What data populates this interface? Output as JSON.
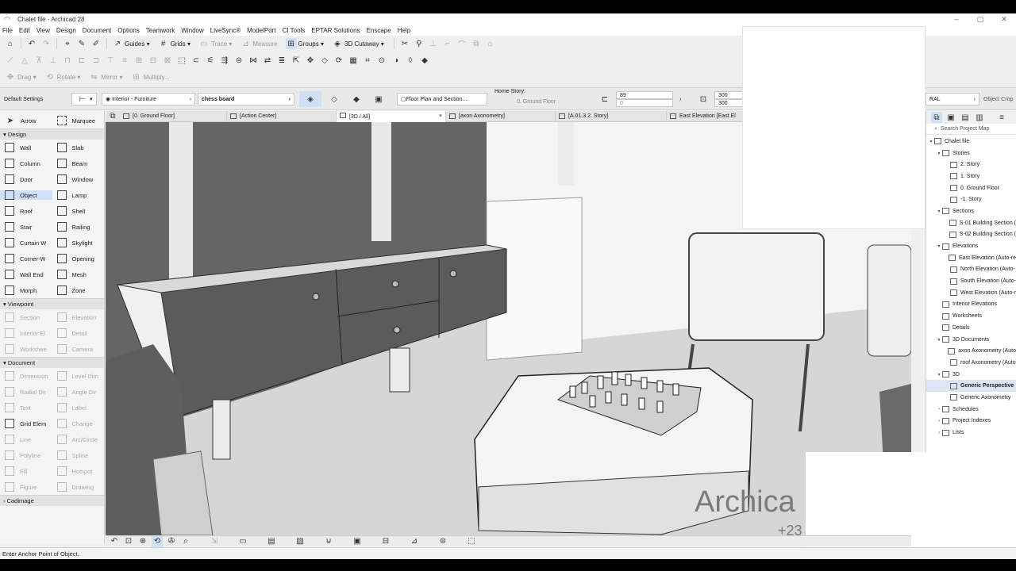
{
  "window": {
    "title": "Chalet file - Archicad 28",
    "controls": [
      "–",
      "▢",
      "✕"
    ]
  },
  "menu": [
    "File",
    "Edit",
    "View",
    "Design",
    "Document",
    "Options",
    "Teamwork",
    "Window",
    "LiveSync®",
    "ModelPort",
    "CI Tools",
    "EPTAR Solutions",
    "Enscape",
    "Help"
  ],
  "toolbar1": {
    "guides": "Guides",
    "grids": "Grids",
    "trace": "Trace",
    "measure": "Measure",
    "groups": "Groups",
    "cutaway": "3D Cutaway"
  },
  "toolbar3": {
    "drag": "Drag",
    "rotate": "Rotate",
    "mirror": "Mirror",
    "multiply": "Multiply..."
  },
  "infobox": {
    "default_settings": "Default Settings",
    "layer": "Interior - Furniture",
    "object_name": "chess board",
    "view_mode": "Floor Plan and Section...",
    "home_story_label": "Home Story:",
    "home_story": "0. Ground Floor",
    "elev1": "89",
    "elev2": "0",
    "dim1": "300",
    "dim2": "300",
    "right_field": "RAL",
    "object_crop": "Object Crop"
  },
  "tabs": [
    {
      "label": "[0. Ground Floor]",
      "active": false
    },
    {
      "label": "[Action Center]",
      "active": false
    },
    {
      "label": "[3D / All]",
      "active": true,
      "close": "×"
    },
    {
      "label": "[axon Axonometry]",
      "active": false
    },
    {
      "label": "[A.01.3 2. Story]",
      "active": false
    },
    {
      "label": "East Elevation [East El",
      "active": false
    }
  ],
  "toolbox": {
    "top": [
      {
        "label": "Arrow"
      },
      {
        "label": "Marquee"
      }
    ],
    "sections": [
      {
        "title": "Design",
        "tools": [
          {
            "label": "Wall"
          },
          {
            "label": "Slab"
          },
          {
            "label": "Column"
          },
          {
            "label": "Beam"
          },
          {
            "label": "Door"
          },
          {
            "label": "Window"
          },
          {
            "label": "Object",
            "selected": true
          },
          {
            "label": "Lamp"
          },
          {
            "label": "Roof"
          },
          {
            "label": "Shell"
          },
          {
            "label": "Stair"
          },
          {
            "label": "Railing"
          },
          {
            "label": "Curtain W"
          },
          {
            "label": "Skylight"
          },
          {
            "label": "Corner-W"
          },
          {
            "label": "Opening"
          },
          {
            "label": "Wall End"
          },
          {
            "label": "Mesh"
          },
          {
            "label": "Morph"
          },
          {
            "label": "Zone"
          }
        ]
      },
      {
        "title": "Viewpoint",
        "tools": [
          {
            "label": "Section",
            "dim": true
          },
          {
            "label": "Elevation",
            "dim": true
          },
          {
            "label": "Interior El",
            "dim": true
          },
          {
            "label": "Detail",
            "dim": true
          },
          {
            "label": "Workshee",
            "dim": true
          },
          {
            "label": "Camera",
            "dim": true
          }
        ]
      },
      {
        "title": "Document",
        "tools": [
          {
            "label": "Dimension",
            "dim": true
          },
          {
            "label": "Level Dim",
            "dim": true
          },
          {
            "label": "Radial Dir",
            "dim": true
          },
          {
            "label": "Angle Dir",
            "dim": true
          },
          {
            "label": "Text",
            "dim": true
          },
          {
            "label": "Label",
            "dim": true
          },
          {
            "label": "Grid Elem"
          },
          {
            "label": "Change",
            "dim": true
          },
          {
            "label": "Line",
            "dim": true
          },
          {
            "label": "Arc/Circle",
            "dim": true
          },
          {
            "label": "Polyline",
            "dim": true
          },
          {
            "label": "Spline",
            "dim": true
          },
          {
            "label": "Fill",
            "dim": true
          },
          {
            "label": "Hotspot",
            "dim": true
          },
          {
            "label": "Figure",
            "dim": true
          },
          {
            "label": "Drawing",
            "dim": true
          }
        ]
      }
    ],
    "last_section": "Cadimage"
  },
  "navigator": {
    "search_placeholder": "Search Project Map",
    "items": [
      {
        "label": "Chalet file",
        "level": 0,
        "arrow": "▾"
      },
      {
        "label": "Stories",
        "level": 1,
        "arrow": "▾"
      },
      {
        "label": "2. Story",
        "level": 2,
        "arrow": ""
      },
      {
        "label": "1. Story",
        "level": 2,
        "arrow": ""
      },
      {
        "label": "0. Ground Floor",
        "level": 2,
        "arrow": ""
      },
      {
        "label": "-1. Story",
        "level": 2,
        "arrow": ""
      },
      {
        "label": "Sections",
        "level": 1,
        "arrow": "▾"
      },
      {
        "label": "S-01 Building Section (",
        "level": 2,
        "arrow": ""
      },
      {
        "label": "S-02 Building Section (",
        "level": 2,
        "arrow": ""
      },
      {
        "label": "Elevations",
        "level": 1,
        "arrow": "▾"
      },
      {
        "label": "East Elevation (Auto-re",
        "level": 2,
        "arrow": ""
      },
      {
        "label": "North Elevation (Auto-",
        "level": 2,
        "arrow": ""
      },
      {
        "label": "South Elevation (Auto-",
        "level": 2,
        "arrow": ""
      },
      {
        "label": "West Elevation (Auto-r",
        "level": 2,
        "arrow": ""
      },
      {
        "label": "Interior Elevations",
        "level": 1,
        "arrow": ""
      },
      {
        "label": "Worksheets",
        "level": 1,
        "arrow": ""
      },
      {
        "label": "Details",
        "level": 1,
        "arrow": ""
      },
      {
        "label": "3D Documents",
        "level": 1,
        "arrow": "▾"
      },
      {
        "label": "axon Axonometry (Auto",
        "level": 2,
        "arrow": ""
      },
      {
        "label": "roof Axonometry (Auto",
        "level": 2,
        "arrow": ""
      },
      {
        "label": "3D",
        "level": 1,
        "arrow": "▾"
      },
      {
        "label": "Generic Perspective",
        "level": 2,
        "arrow": "",
        "selected": true
      },
      {
        "label": "Generic Axonometry",
        "level": 2,
        "arrow": ""
      },
      {
        "label": "Schedules",
        "level": 1,
        "arrow": "›"
      },
      {
        "label": "Project Indexes",
        "level": 1,
        "arrow": "›"
      },
      {
        "label": "Lists",
        "level": 1,
        "arrow": "›"
      }
    ]
  },
  "watermark": {
    "line1": "Archica",
    "line2": "+23"
  },
  "status": "Enter Anchor Point of Object.",
  "colors": {
    "selection": "#cfe0f7",
    "viewport_bg": "#d8d8d8",
    "dark_furniture": "#5b5b5b"
  }
}
